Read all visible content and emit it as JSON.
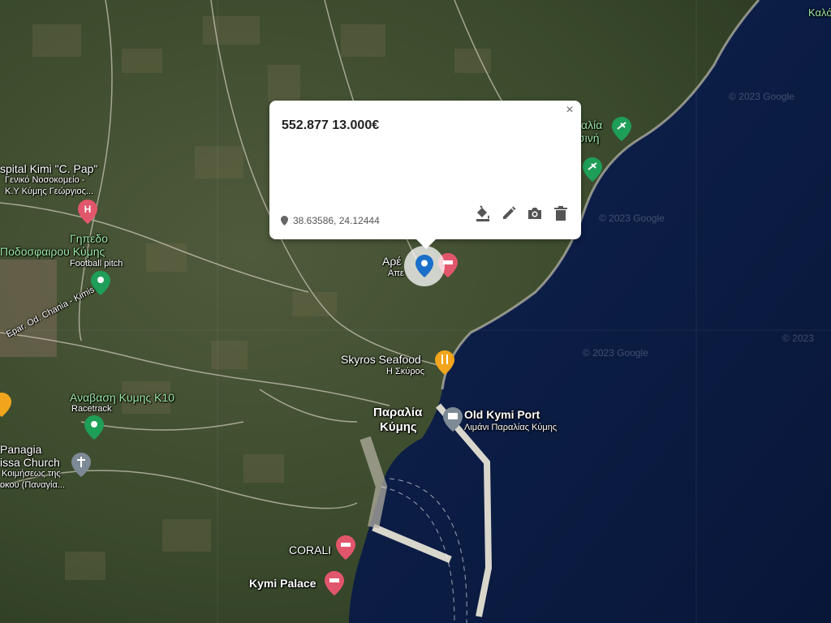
{
  "popup": {
    "title": "552.877 13.000€",
    "coords": "38.63586, 24.12444",
    "close_glyph": "×",
    "actions": [
      "paint-bucket-icon",
      "pencil-icon",
      "camera-icon",
      "trash-icon"
    ]
  },
  "map": {
    "type": "satellite",
    "labels": {
      "hospital_1": "spital Kimi \"C. Pap\"",
      "hospital_2": "Γενικό Νοσοκομείο -",
      "hospital_3": "Κ.Υ Κύμης  Γεώργιος...",
      "pitch_1": "Γηπεδο",
      "pitch_2": "Ποδοσφαιρου Κύμης",
      "pitch_3": "Football pitch",
      "road": "Epar. Od. Chania - Kimis",
      "race_1": "Αναβαση Κυμης Κ10",
      "race_2": "Racetrack",
      "church_1": "Panagia",
      "church_2": "issa Church",
      "church_3": "Κοιμήσεως της",
      "church_4": "οκου (Παναγία...",
      "skyros_1": "Skyros Seafood",
      "skyros_2": "Η Σκύρος",
      "beach_1": "Παραλία",
      "beach_2": "Κύμης",
      "port_1": "Old Kymi Port",
      "port_2": "Λιμάνι Παραλίας Κύμης",
      "corali": "CORALI",
      "palace": "Kymi Palace",
      "arepa_1": "Αρέ",
      "arepa_2": "Απε",
      "top_right": "Καλό",
      "paralia_top_1": "αλία",
      "paralia_top_2": "σινή"
    },
    "watermarks": [
      "© 2023 Google",
      "© 2023 Google",
      "© 2023 Google",
      "© 2023"
    ]
  }
}
